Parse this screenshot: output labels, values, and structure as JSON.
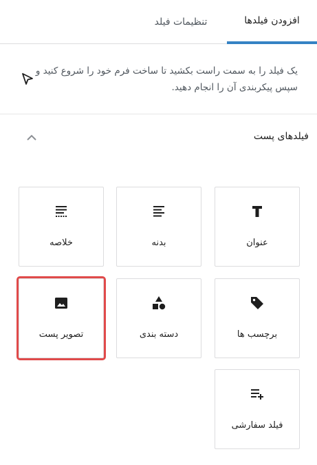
{
  "tabs": {
    "add_fields": "افزودن فیلدها",
    "field_settings": "تنظیمات فیلد"
  },
  "hint": {
    "text": "یک فیلد را به سمت راست بکشید تا ساخت فرم خود را شروع کنید و سپس پیکربندی آن را انجام دهید."
  },
  "section": {
    "title": "فیلدهای پست"
  },
  "fields": {
    "title": "عنوان",
    "body": "بدنه",
    "excerpt": "خلاصه",
    "tags": "برچسب ها",
    "categories": "دسته بندی",
    "featured_image": "تصویر پست",
    "custom_field": "فیلد سفارشی"
  },
  "colors": {
    "accent": "#3582c4",
    "highlight": "#e04a4a",
    "icon": "#1e1e1e"
  },
  "icons": {
    "title": "text-t-icon",
    "body": "align-justify-icon",
    "excerpt": "excerpt-lines-icon",
    "tags": "tag-icon",
    "categories": "shapes-icon",
    "featured_image": "image-icon",
    "custom_field": "list-add-icon"
  }
}
